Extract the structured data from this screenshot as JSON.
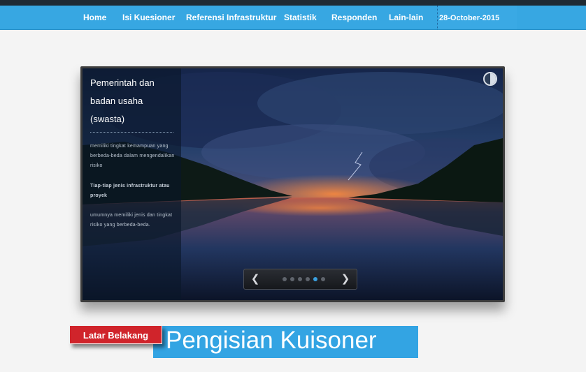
{
  "nav": {
    "items": [
      {
        "label": "Home"
      },
      {
        "label": "Isi Kuesioner"
      },
      {
        "label": "Referensi Infrastruktur"
      },
      {
        "label": "Statistik"
      },
      {
        "label": "Responden"
      },
      {
        "label": "Lain-lain"
      }
    ],
    "date": "28-October-2015"
  },
  "slider": {
    "caption": {
      "title": "Pemerintah dan badan usaha (swasta)",
      "p1": "memiliki tingkat kemampuan yang berbeda-beda dalam mengendalikan risiko",
      "p2": "Tiap-tiap jenis infrastruktur atau proyek",
      "p3": "umumnya memiliki jenis dan tingkat risiko yang berbeda-beda."
    },
    "controls": {
      "prev_icon": "chevron-left-icon",
      "next_icon": "chevron-right-icon",
      "pause_icon": "pause-icon",
      "dot_count": 6,
      "active_dot": 4
    }
  },
  "section": {
    "badge": "Latar Belakang",
    "title": "Pengisian Kuisoner"
  },
  "colors": {
    "nav_bg": "#37a7e2",
    "badge_red": "#d0242b",
    "heading_blue": "#33a4e3"
  }
}
